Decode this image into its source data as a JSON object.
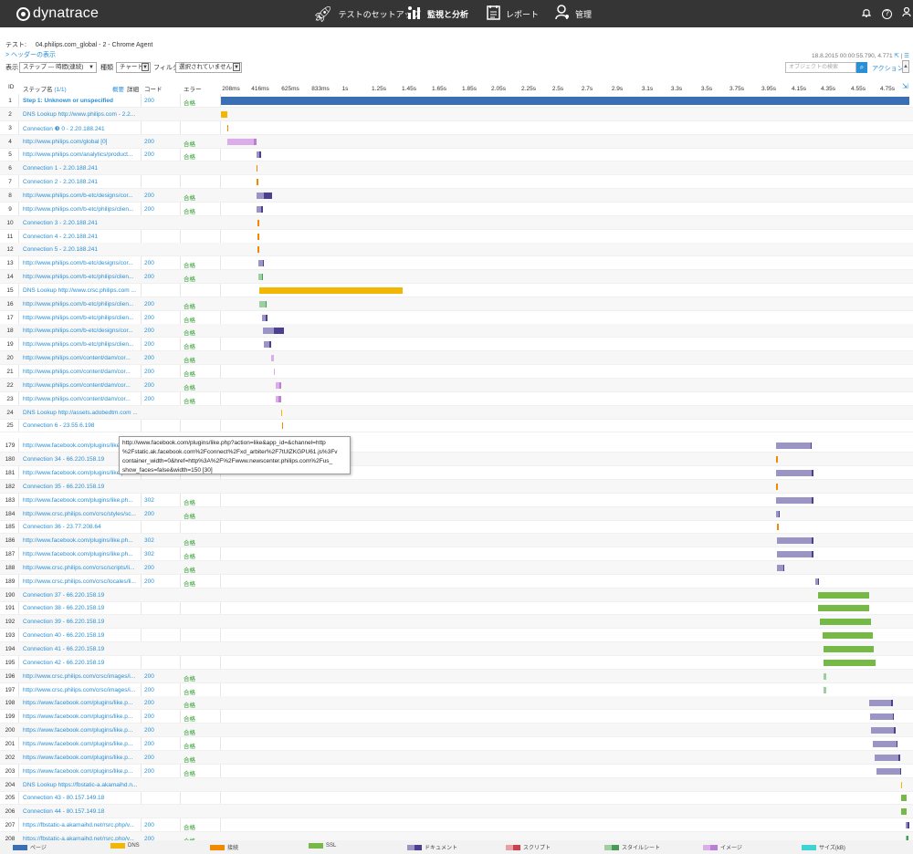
{
  "app": {
    "logo": "dynatrace"
  },
  "nav": [
    {
      "label": "テストのセットアップ",
      "icon": "rocket-icon"
    },
    {
      "label": "監視と分析",
      "icon": "bar-chart-icon"
    },
    {
      "label": "レポート",
      "icon": "report-icon"
    },
    {
      "label": "管理",
      "icon": "user-admin-icon"
    }
  ],
  "test": {
    "label": "テスト:",
    "name": "04.philips.com_global - 2 - Chrome Agent"
  },
  "header_link": "> ヘッダーの表示",
  "date_info": "18.8.2015 00:00:55.790, 4.771",
  "filters": {
    "display_label": "表示",
    "display_value": "ステップ ― 時間(連続)",
    "type_label": "種類",
    "type_value": "チャート",
    "filter_label": "フィルタ",
    "filter_value": "選択されていません",
    "search_placeholder": "オブジェクトの検索",
    "action_label": "アクション"
  },
  "columns": {
    "id": "ID",
    "step": "ステップ名",
    "step_count": "(1/1)",
    "summary": "概要",
    "detail": "詳細",
    "code": "コード",
    "error": "エラー"
  },
  "ticks": [
    "208ms",
    "416ms",
    "625ms",
    "833ms",
    "1s",
    "1.25s",
    "1.45s",
    "1.65s",
    "1.85s",
    "2.05s",
    "2.25s",
    "2.5s",
    "2.7s",
    "2.9s",
    "3.1s",
    "3.3s",
    "3.5s",
    "3.75s",
    "3.95s",
    "4.15s",
    "4.35s",
    "4.55s",
    "4.75s"
  ],
  "colors": {
    "page": "#3b6fb5",
    "dns": "#f2b705",
    "connect": "#f18a00",
    "ssl": "#76b947",
    "document": "#9b95c6",
    "document_dark": "#4b3f8f",
    "script": "#e8a0a6",
    "script_dark": "#c8434f",
    "stylesheet": "#9fcfa1",
    "stylesheet_dark": "#4a9a5c",
    "image": "#dcaee9",
    "image_dark": "#b97fd0",
    "size": "#3fd3d3"
  },
  "rows_top": [
    {
      "id": "1",
      "name": "Step 1: Unknown or unspecified",
      "code": "200",
      "error": "合格",
      "step": true,
      "segs": [
        [
          0,
          4.771,
          "page"
        ]
      ]
    },
    {
      "id": "2",
      "name": "DNS Lookup http://www.philips.com - 2.2...",
      "code": "",
      "error": "",
      "segs": [
        [
          0.004,
          0.13,
          "dns"
        ]
      ]
    },
    {
      "id": "3",
      "name": "Connection ❸ 0 - 2.20.188.241",
      "code": "",
      "error": "",
      "segs": [
        [
          0.13,
          0.14,
          "connect"
        ]
      ]
    },
    {
      "id": "4",
      "name": "http://www.philips.com/global [0]",
      "code": "200",
      "error": "合格",
      "segs": [
        [
          0.14,
          0.37,
          "image"
        ],
        [
          0.37,
          0.385,
          "image_dark"
        ]
      ]
    },
    {
      "id": "5",
      "name": "http://www.philips.com/analytics/product...",
      "code": "200",
      "error": "合格",
      "segs": [
        [
          0.385,
          0.41,
          "document"
        ],
        [
          0.41,
          0.42,
          "document_dark"
        ]
      ]
    },
    {
      "id": "6",
      "name": "Connection 1 - 2.20.188.241",
      "code": "",
      "error": "",
      "segs": [
        [
          0.385,
          0.392,
          "connect"
        ]
      ]
    },
    {
      "id": "7",
      "name": "Connection 2 - 2.20.188.241",
      "code": "",
      "error": "",
      "segs": [
        [
          0.39,
          0.397,
          "connect"
        ]
      ]
    },
    {
      "id": "8",
      "name": "http://www.philips.com/b-etc/designs/cor...",
      "code": "200",
      "error": "合格",
      "segs": [
        [
          0.39,
          0.44,
          "document"
        ],
        [
          0.44,
          0.5,
          "document_dark"
        ]
      ]
    },
    {
      "id": "9",
      "name": "http://www.philips.com/b-etc/philips/clien...",
      "code": "200",
      "error": "合格",
      "segs": [
        [
          0.39,
          0.42,
          "document"
        ],
        [
          0.42,
          0.435,
          "document_dark"
        ]
      ]
    },
    {
      "id": "10",
      "name": "Connection 3 - 2.20.188.241",
      "code": "",
      "error": "",
      "segs": [
        [
          0.395,
          0.402,
          "connect"
        ]
      ]
    },
    {
      "id": "11",
      "name": "Connection 4 - 2.20.188.241",
      "code": "",
      "error": "",
      "segs": [
        [
          0.395,
          0.402,
          "connect"
        ]
      ]
    },
    {
      "id": "12",
      "name": "Connection 5 - 2.20.188.241",
      "code": "",
      "error": "",
      "segs": [
        [
          0.395,
          0.402,
          "connect"
        ]
      ]
    },
    {
      "id": "13",
      "name": "http://www.philips.com/b-etc/designs/cor...",
      "code": "200",
      "error": "合格",
      "segs": [
        [
          0.4,
          0.43,
          "document"
        ],
        [
          0.43,
          0.44,
          "document_dark"
        ]
      ]
    },
    {
      "id": "14",
      "name": "http://www.philips.com/b-etc/philips/clien...",
      "code": "200",
      "error": "合格",
      "segs": [
        [
          0.4,
          0.425,
          "stylesheet"
        ],
        [
          0.425,
          0.43,
          "stylesheet_dark"
        ]
      ]
    },
    {
      "id": "15",
      "name": "DNS Lookup http://www.crsc.philips.com ...",
      "code": "",
      "error": "",
      "segs": [
        [
          0.405,
          1.42,
          "dns"
        ]
      ]
    },
    {
      "id": "16",
      "name": "http://www.philips.com/b-etc/philips/clien...",
      "code": "200",
      "error": "合格",
      "segs": [
        [
          0.405,
          0.45,
          "stylesheet"
        ],
        [
          0.45,
          0.46,
          "stylesheet_dark"
        ]
      ]
    },
    {
      "id": "17",
      "name": "http://www.philips.com/b-etc/philips/clien...",
      "code": "200",
      "error": "合格",
      "segs": [
        [
          0.425,
          0.455,
          "document"
        ],
        [
          0.455,
          0.465,
          "document_dark"
        ]
      ]
    },
    {
      "id": "18",
      "name": "http://www.philips.com/b-etc/designs/cor...",
      "code": "200",
      "error": "合格",
      "segs": [
        [
          0.43,
          0.51,
          "document"
        ],
        [
          0.51,
          0.58,
          "document_dark"
        ]
      ]
    },
    {
      "id": "19",
      "name": "http://www.philips.com/b-etc/philips/clien...",
      "code": "200",
      "error": "合格",
      "segs": [
        [
          0.44,
          0.48,
          "document"
        ],
        [
          0.48,
          0.49,
          "document_dark"
        ]
      ]
    },
    {
      "id": "20",
      "name": "http://www.philips.com/content/dam/cor...",
      "code": "200",
      "error": "合格",
      "segs": [
        [
          0.49,
          0.51,
          "image"
        ]
      ]
    },
    {
      "id": "21",
      "name": "http://www.philips.com/content/dam/cor...",
      "code": "200",
      "error": "合格",
      "segs": [
        [
          0.51,
          0.52,
          "image"
        ]
      ]
    },
    {
      "id": "22",
      "name": "http://www.philips.com/content/dam/cor...",
      "code": "200",
      "error": "合格",
      "segs": [
        [
          0.52,
          0.55,
          "image"
        ],
        [
          0.55,
          0.56,
          "image_dark"
        ]
      ]
    },
    {
      "id": "23",
      "name": "http://www.philips.com/content/dam/cor...",
      "code": "200",
      "error": "合格",
      "segs": [
        [
          0.52,
          0.545,
          "image"
        ],
        [
          0.545,
          0.56,
          "image_dark"
        ]
      ]
    },
    {
      "id": "24",
      "name": "DNS Lookup http://assets.adobedtm.com ...",
      "code": "",
      "error": "",
      "segs": [
        [
          0.56,
          0.565,
          "dns"
        ]
      ]
    },
    {
      "id": "25",
      "name": "Connection 6 - 23.55.6.198",
      "code": "",
      "error": "",
      "segs": [
        [
          0.565,
          0.572,
          "connect"
        ]
      ]
    }
  ],
  "rows_bottom": [
    {
      "id": "179",
      "name": "http://www.facebook.com/plugins/like.ph...",
      "code": "",
      "error": "",
      "segs": [
        [
          4.77,
          5.06,
          "document"
        ],
        [
          5.06,
          5.07,
          "document_dark"
        ]
      ]
    },
    {
      "id": "180",
      "name": "Connection 34 - 66.220.158.19",
      "code": "",
      "error": "",
      "segs": [
        [
          4.77,
          4.775,
          "connect"
        ]
      ]
    },
    {
      "id": "181",
      "name": "http://www.facebook.com/plugins/like.ph...",
      "code": "",
      "error": "",
      "segs": [
        [
          4.77,
          5.07,
          "document"
        ],
        [
          5.07,
          5.08,
          "document_dark"
        ]
      ]
    },
    {
      "id": "182",
      "name": "Connection 35 - 66.220.158.19",
      "code": "",
      "error": "",
      "segs": [
        [
          4.77,
          4.775,
          "connect"
        ]
      ]
    },
    {
      "id": "183",
      "name": "http://www.facebook.com/plugins/like.ph...",
      "code": "302",
      "error": "合格",
      "segs": [
        [
          4.77,
          5.07,
          "document"
        ],
        [
          5.07,
          5.08,
          "document_dark"
        ]
      ]
    },
    {
      "id": "184",
      "name": "http://www.crsc.philips.com/crsc/styles/sc...",
      "code": "200",
      "error": "合格",
      "segs": [
        [
          4.77,
          4.79,
          "document"
        ],
        [
          4.79,
          4.8,
          "document_dark"
        ]
      ]
    },
    {
      "id": "185",
      "name": "Connection 36 - 23.77.208.64",
      "code": "",
      "error": "",
      "segs": [
        [
          4.78,
          4.785,
          "connect"
        ]
      ]
    },
    {
      "id": "186",
      "name": "http://www.facebook.com/plugins/like.ph...",
      "code": "302",
      "error": "合格",
      "segs": [
        [
          4.78,
          5.07,
          "document"
        ],
        [
          5.07,
          5.08,
          "document_dark"
        ]
      ]
    },
    {
      "id": "187",
      "name": "http://www.facebook.com/plugins/like.ph...",
      "code": "302",
      "error": "合格",
      "segs": [
        [
          4.78,
          5.07,
          "document"
        ],
        [
          5.07,
          5.08,
          "document_dark"
        ]
      ]
    },
    {
      "id": "188",
      "name": "http://www.crsc.philips.com/crsc/scripts/li...",
      "code": "200",
      "error": "合格",
      "segs": [
        [
          4.78,
          4.83,
          "document"
        ],
        [
          4.83,
          4.84,
          "document_dark"
        ]
      ]
    },
    {
      "id": "189",
      "name": "http://www.crsc.philips.com/crsc/locales/li...",
      "code": "200",
      "error": "合格",
      "segs": [
        [
          5.1,
          5.12,
          "document"
        ],
        [
          5.12,
          5.13,
          "document_dark"
        ]
      ]
    },
    {
      "id": "190",
      "name": "Connection 37 - 66.220.158.19",
      "code": "",
      "error": "",
      "segs": [
        [
          5.12,
          5.55,
          "ssl"
        ]
      ]
    },
    {
      "id": "191",
      "name": "Connection 38 - 66.220.158.19",
      "code": "",
      "error": "",
      "segs": [
        [
          5.12,
          5.55,
          "ssl"
        ]
      ]
    },
    {
      "id": "192",
      "name": "Connection 39 - 66.220.158.19",
      "code": "",
      "error": "",
      "segs": [
        [
          5.14,
          5.57,
          "ssl"
        ]
      ]
    },
    {
      "id": "193",
      "name": "Connection 40 - 66.220.158.19",
      "code": "",
      "error": "",
      "segs": [
        [
          5.16,
          5.58,
          "ssl"
        ]
      ]
    },
    {
      "id": "194",
      "name": "Connection 41 - 66.220.158.19",
      "code": "",
      "error": "",
      "segs": [
        [
          5.17,
          5.59,
          "ssl"
        ]
      ]
    },
    {
      "id": "195",
      "name": "Connection 42 - 66.220.158.19",
      "code": "",
      "error": "",
      "segs": [
        [
          5.17,
          5.61,
          "ssl"
        ]
      ]
    },
    {
      "id": "196",
      "name": "http://www.crsc.philips.com/crsc/images/i...",
      "code": "200",
      "error": "合格",
      "segs": [
        [
          5.17,
          5.19,
          "stylesheet"
        ]
      ]
    },
    {
      "id": "197",
      "name": "http://www.crsc.philips.com/crsc/images/i...",
      "code": "200",
      "error": "合格",
      "segs": [
        [
          5.17,
          5.19,
          "stylesheet"
        ]
      ]
    },
    {
      "id": "198",
      "name": "https://www.facebook.com/plugins/like.p...",
      "code": "200",
      "error": "合格",
      "segs": [
        [
          5.55,
          5.74,
          "document"
        ],
        [
          5.74,
          5.75,
          "document_dark"
        ]
      ]
    },
    {
      "id": "199",
      "name": "https://www.facebook.com/plugins/like.p...",
      "code": "200",
      "error": "合格",
      "segs": [
        [
          5.56,
          5.75,
          "document"
        ],
        [
          5.75,
          5.76,
          "document_dark"
        ]
      ]
    },
    {
      "id": "200",
      "name": "https://www.facebook.com/plugins/like.p...",
      "code": "200",
      "error": "合格",
      "segs": [
        [
          5.57,
          5.76,
          "document"
        ],
        [
          5.76,
          5.77,
          "document_dark"
        ]
      ]
    },
    {
      "id": "201",
      "name": "https://www.facebook.com/plugins/like.p...",
      "code": "200",
      "error": "合格",
      "segs": [
        [
          5.58,
          5.78,
          "document"
        ],
        [
          5.78,
          5.79,
          "document_dark"
        ]
      ]
    },
    {
      "id": "202",
      "name": "https://www.facebook.com/plugins/like.p...",
      "code": "200",
      "error": "合格",
      "segs": [
        [
          5.6,
          5.8,
          "document"
        ],
        [
          5.8,
          5.81,
          "document_dark"
        ]
      ]
    },
    {
      "id": "203",
      "name": "https://www.facebook.com/plugins/like.p...",
      "code": "200",
      "error": "合格",
      "segs": [
        [
          5.61,
          5.81,
          "document"
        ],
        [
          5.81,
          5.82,
          "document_dark"
        ]
      ]
    },
    {
      "id": "204",
      "name": "DNS Lookup https://fbstatic-a.akamaihd.n...",
      "code": "",
      "error": "",
      "segs": [
        [
          5.82,
          5.825,
          "dns"
        ]
      ]
    },
    {
      "id": "205",
      "name": "Connection 43 - 80.157.149.18",
      "code": "",
      "error": "",
      "segs": [
        [
          5.82,
          5.87,
          "ssl"
        ]
      ]
    },
    {
      "id": "206",
      "name": "Connection 44 - 80.157.149.18",
      "code": "",
      "error": "",
      "segs": [
        [
          5.82,
          5.87,
          "ssl"
        ]
      ]
    },
    {
      "id": "207",
      "name": "https://fbstatic-a.akamaihd.net/rsrc.php/v...",
      "code": "200",
      "error": "合格",
      "segs": [
        [
          5.86,
          5.875,
          "document"
        ],
        [
          5.875,
          5.885,
          "document_dark"
        ]
      ]
    },
    {
      "id": "208",
      "name": "https://fbstatic-a.akamaihd.net/rsrc.php/v...",
      "code": "200",
      "error": "合格",
      "segs": [
        [
          5.86,
          5.87,
          "stylesheet"
        ],
        [
          5.87,
          5.88,
          "stylesheet_dark"
        ]
      ]
    }
  ],
  "tooltip": [
    "http://www.facebook.com/plugins/like.php?action=like&app_id=&channel=http",
    "%2Fstatic.ak.facebook.com%2Fconnect%2Fxd_arbiter%2F7tUlZKGPU61.js%3Fv",
    "container_width=0&href=http%3A%2F%2Fwww.newscenter.philips.com%2Fus_",
    "show_faces=false&width=150 [30]"
  ],
  "legend": [
    {
      "label": "ページ",
      "c1": "page"
    },
    {
      "label": "DNS",
      "c1": "dns"
    },
    {
      "label": "接続",
      "c1": "connect"
    },
    {
      "label": "SSL",
      "c1": "ssl"
    },
    {
      "label": "ドキュメント",
      "c1": "document",
      "c2": "document_dark"
    },
    {
      "label": "スクリプト",
      "c1": "script",
      "c2": "script_dark"
    },
    {
      "label": "スタイルシート",
      "c1": "stylesheet",
      "c2": "stylesheet_dark"
    },
    {
      "label": "イメージ",
      "c1": "image",
      "c2": "image_dark"
    },
    {
      "label": "サイズ(kB)",
      "c1": "size"
    }
  ]
}
